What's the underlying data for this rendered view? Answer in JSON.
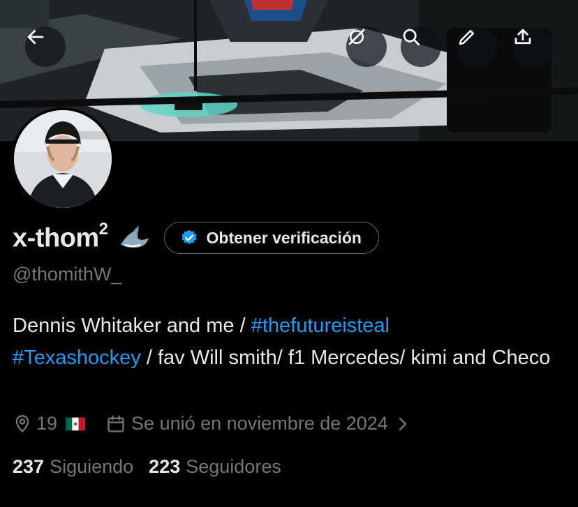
{
  "header": {
    "back_icon": "arrow-left-icon",
    "grok_icon": "grok-icon",
    "search_icon": "search-icon",
    "edit_icon": "pencil-icon",
    "share_icon": "share-icon"
  },
  "profile": {
    "name": "x-thom",
    "name_superscript": "2",
    "name_emoji": "shark",
    "verification_button": "Obtener verificación",
    "handle": "@thomithW_",
    "bio": {
      "text1": "Dennis Whitaker and me / ",
      "hashtag1": "#thefutureisteal",
      "hashtag2": "#Texashockey",
      "text2": " / fav Will smith/ f1 Mercedes/ kimi and Checo"
    },
    "location": "19",
    "location_flag": "Mexico flag",
    "joined": "Se unió en noviembre de 2024",
    "following_count": "237",
    "following_label": "Siguiendo",
    "followers_count": "223",
    "followers_label": "Seguidores"
  },
  "colors": {
    "background": "#000000",
    "text": "#e7e9ea",
    "secondary": "#71767b",
    "accent": "#1d9bf0"
  }
}
